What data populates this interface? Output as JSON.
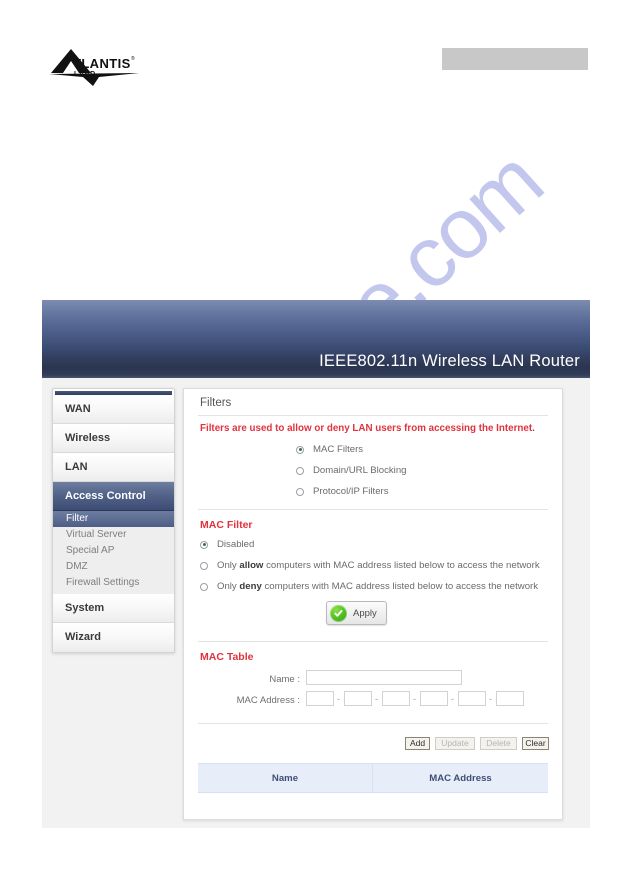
{
  "document": {
    "logo": {
      "brand": "ATLANTIS",
      "sub": "LAND",
      "trademark": "®"
    },
    "header_box_label": ""
  },
  "watermark": {
    "text": "manualshive.com"
  },
  "router_ui": {
    "banner_title": "IEEE802.11n  Wireless LAN Router",
    "sidebar": {
      "main_items": [
        {
          "label": "WAN",
          "active": false
        },
        {
          "label": "Wireless",
          "active": false
        },
        {
          "label": "LAN",
          "active": false
        },
        {
          "label": "Access Control",
          "active": true
        }
      ],
      "sub_items": [
        {
          "label": "Filter",
          "selected": true
        },
        {
          "label": "Virtual Server",
          "selected": false
        },
        {
          "label": "Special AP",
          "selected": false
        },
        {
          "label": "DMZ",
          "selected": false
        },
        {
          "label": "Firewall Settings",
          "selected": false
        }
      ],
      "tail_items": [
        {
          "label": "System",
          "active": false
        },
        {
          "label": "Wizard",
          "active": false
        }
      ]
    },
    "content": {
      "title": "Filters",
      "notice": "Filters are used to allow or deny LAN users from accessing the Internet.",
      "filter_type": {
        "options": [
          {
            "label": "MAC Filters",
            "selected": true
          },
          {
            "label": "Domain/URL Blocking",
            "selected": false
          },
          {
            "label": "Protocol/IP Filters",
            "selected": false
          }
        ]
      },
      "mac_filter": {
        "section_title": "MAC Filter",
        "options": [
          {
            "label": "Disabled",
            "selected": true,
            "pre": "",
            "bold": "",
            "post": ""
          },
          {
            "label": "Only allow computers with MAC address listed below to access the network",
            "selected": false,
            "pre": "Only ",
            "bold": "allow",
            "post": " computers with MAC address listed below to access the network"
          },
          {
            "label": "Only deny computers with MAC address listed below to access the network",
            "selected": false,
            "pre": "Only ",
            "bold": "deny",
            "post": " computers with MAC address listed below to access the network"
          }
        ],
        "apply_label": "Apply"
      },
      "mac_table": {
        "section_title": "MAC Table",
        "name_label": "Name :",
        "name_value": "",
        "mac_label": "MAC Address :",
        "mac_octets": [
          "",
          "",
          "",
          "",
          "",
          ""
        ],
        "separator": "-",
        "buttons": [
          {
            "label": "Add",
            "disabled": false
          },
          {
            "label": "Update",
            "disabled": true
          },
          {
            "label": "Delete",
            "disabled": true
          },
          {
            "label": "Clear",
            "disabled": false
          }
        ],
        "columns": [
          "Name",
          "MAC Address"
        ],
        "rows": []
      }
    }
  },
  "colors": {
    "banner_top": "#7d8cb0",
    "banner_bottom": "#2b3550",
    "accent_red": "#e0333e",
    "active_nav": "#4d5d86",
    "table_header_bg": "#e7eefa",
    "watermark": "#c3c7ee",
    "apply_green": "#56c423"
  }
}
